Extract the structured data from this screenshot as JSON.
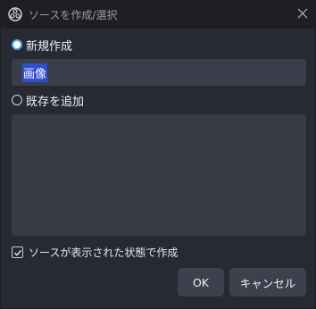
{
  "window": {
    "title": "ソースを作成/選択"
  },
  "dialog": {
    "create_new": {
      "label": "新規作成",
      "selected": true
    },
    "name_input": {
      "value": "画像"
    },
    "add_existing": {
      "label": "既存を追加",
      "selected": false
    },
    "existing_sources": [],
    "make_visible": {
      "label": "ソースが表示された状態で作成",
      "checked": true
    },
    "buttons": {
      "ok": "OK",
      "cancel": "キャンセル"
    }
  },
  "colors": {
    "accent": "#4aa7e8",
    "selection": "#2f4fd0",
    "dialog_bg": "#272a33",
    "field_bg": "#3b3e4a"
  }
}
